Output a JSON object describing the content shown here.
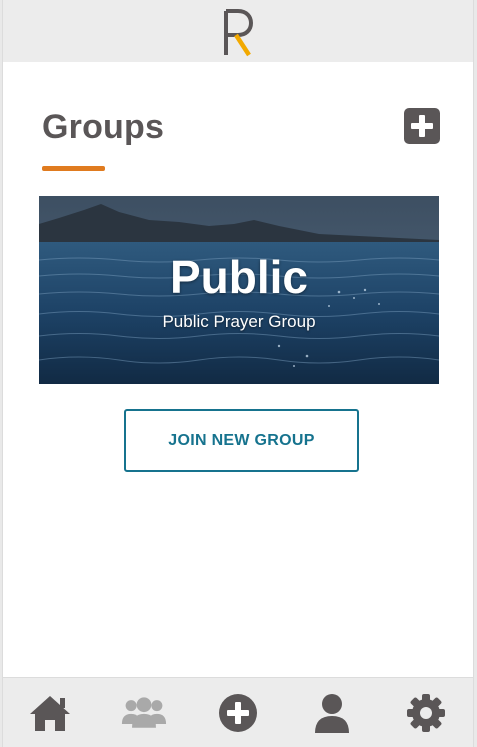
{
  "header": {
    "logo_letter": "R",
    "logo_icon": "app-logo-r",
    "logo_color_gray": "#5a5657",
    "logo_color_accent": "#f2a900"
  },
  "page": {
    "title": "Groups",
    "add_button_icon": "plus-square-icon",
    "accent_color": "#e07b1f"
  },
  "groups": [
    {
      "name": "Public",
      "description": "Public Prayer Group",
      "image": "ocean-and-mountains-photo"
    }
  ],
  "join_button": {
    "label": "JOIN NEW GROUP",
    "color": "#16738e"
  },
  "bottom_nav": {
    "items": [
      {
        "name": "home",
        "icon": "home-icon",
        "active": true
      },
      {
        "name": "groups",
        "icon": "users-icon",
        "active": false
      },
      {
        "name": "add",
        "icon": "plus-circle-icon",
        "active": true
      },
      {
        "name": "profile",
        "icon": "user-icon",
        "active": true
      },
      {
        "name": "settings",
        "icon": "gear-icon",
        "active": true
      }
    ],
    "active_color": "#5a5657",
    "inactive_color": "#a9a9a9"
  }
}
